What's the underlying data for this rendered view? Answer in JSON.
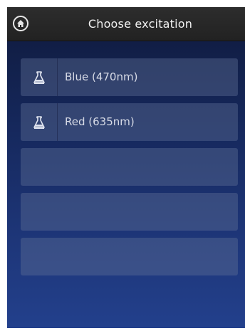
{
  "header": {
    "title": "Choose excitation",
    "home_icon": "home-icon"
  },
  "list": {
    "items": [
      {
        "label": "Blue (470nm)",
        "icon": "flask-icon"
      },
      {
        "label": "Red (635nm)",
        "icon": "flask-icon"
      },
      {
        "label": ""
      },
      {
        "label": ""
      },
      {
        "label": ""
      }
    ]
  },
  "colors": {
    "header_bg": "#262626",
    "screen_top": "#0f1a3c",
    "screen_bottom": "#23408c",
    "item_bg": "#5a6a92",
    "text": "#d7dbe6"
  }
}
